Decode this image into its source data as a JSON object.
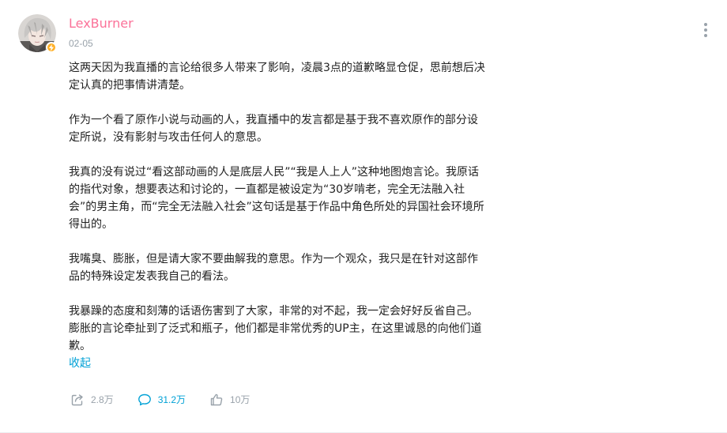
{
  "post": {
    "author": "LexBurner",
    "date": "02-05",
    "paragraphs": [
      "这两天因为我直播的言论给很多人带来了影响，凌晨3点的道歉略显仓促，思前想后决定认真的把事情讲清楚。",
      "作为一个看了原作小说与动画的人，我直播中的发言都是基于我不喜欢原作的部分设定所说，没有影射与攻击任何人的意思。",
      "我真的没有说过“看这部动画的人是底层人民”“我是人上人”这种地图炮言论。我原话的指代对象，想要表达和讨论的，一直都是被设定为“30岁啃老，完全无法融入社会”的男主角，而“完全无法融入社会”这句话是基于作品中角色所处的异国社会环境所得出的。",
      "我嘴臭、膨胀，但是请大家不要曲解我的意思。作为一个观众，我只是在针对这部作品的特殊设定发表我自己的看法。",
      "我暴躁的态度和刻薄的话语伤害到了大家，非常的对不起，我一定会好好反省自己。膨胀的言论牵扯到了泛式和瓶子，他们都是非常优秀的UP主，在这里诚恳的向他们道歉。"
    ],
    "collapse_label": "收起"
  },
  "actions": {
    "share": {
      "icon": "share-icon",
      "count": "2.8万"
    },
    "comment": {
      "icon": "comment-icon",
      "count": "31.2万"
    },
    "like": {
      "icon": "thumbs-up-icon",
      "count": "10万"
    }
  },
  "icons": {
    "avatar": "avatar",
    "verified": "lightning-badge-icon",
    "more": "more-vertical-icon"
  },
  "colors": {
    "username": "#fb7299",
    "link": "#00a1d6",
    "meta": "#99a2aa",
    "text": "#222222",
    "badge": "#ffb027"
  }
}
